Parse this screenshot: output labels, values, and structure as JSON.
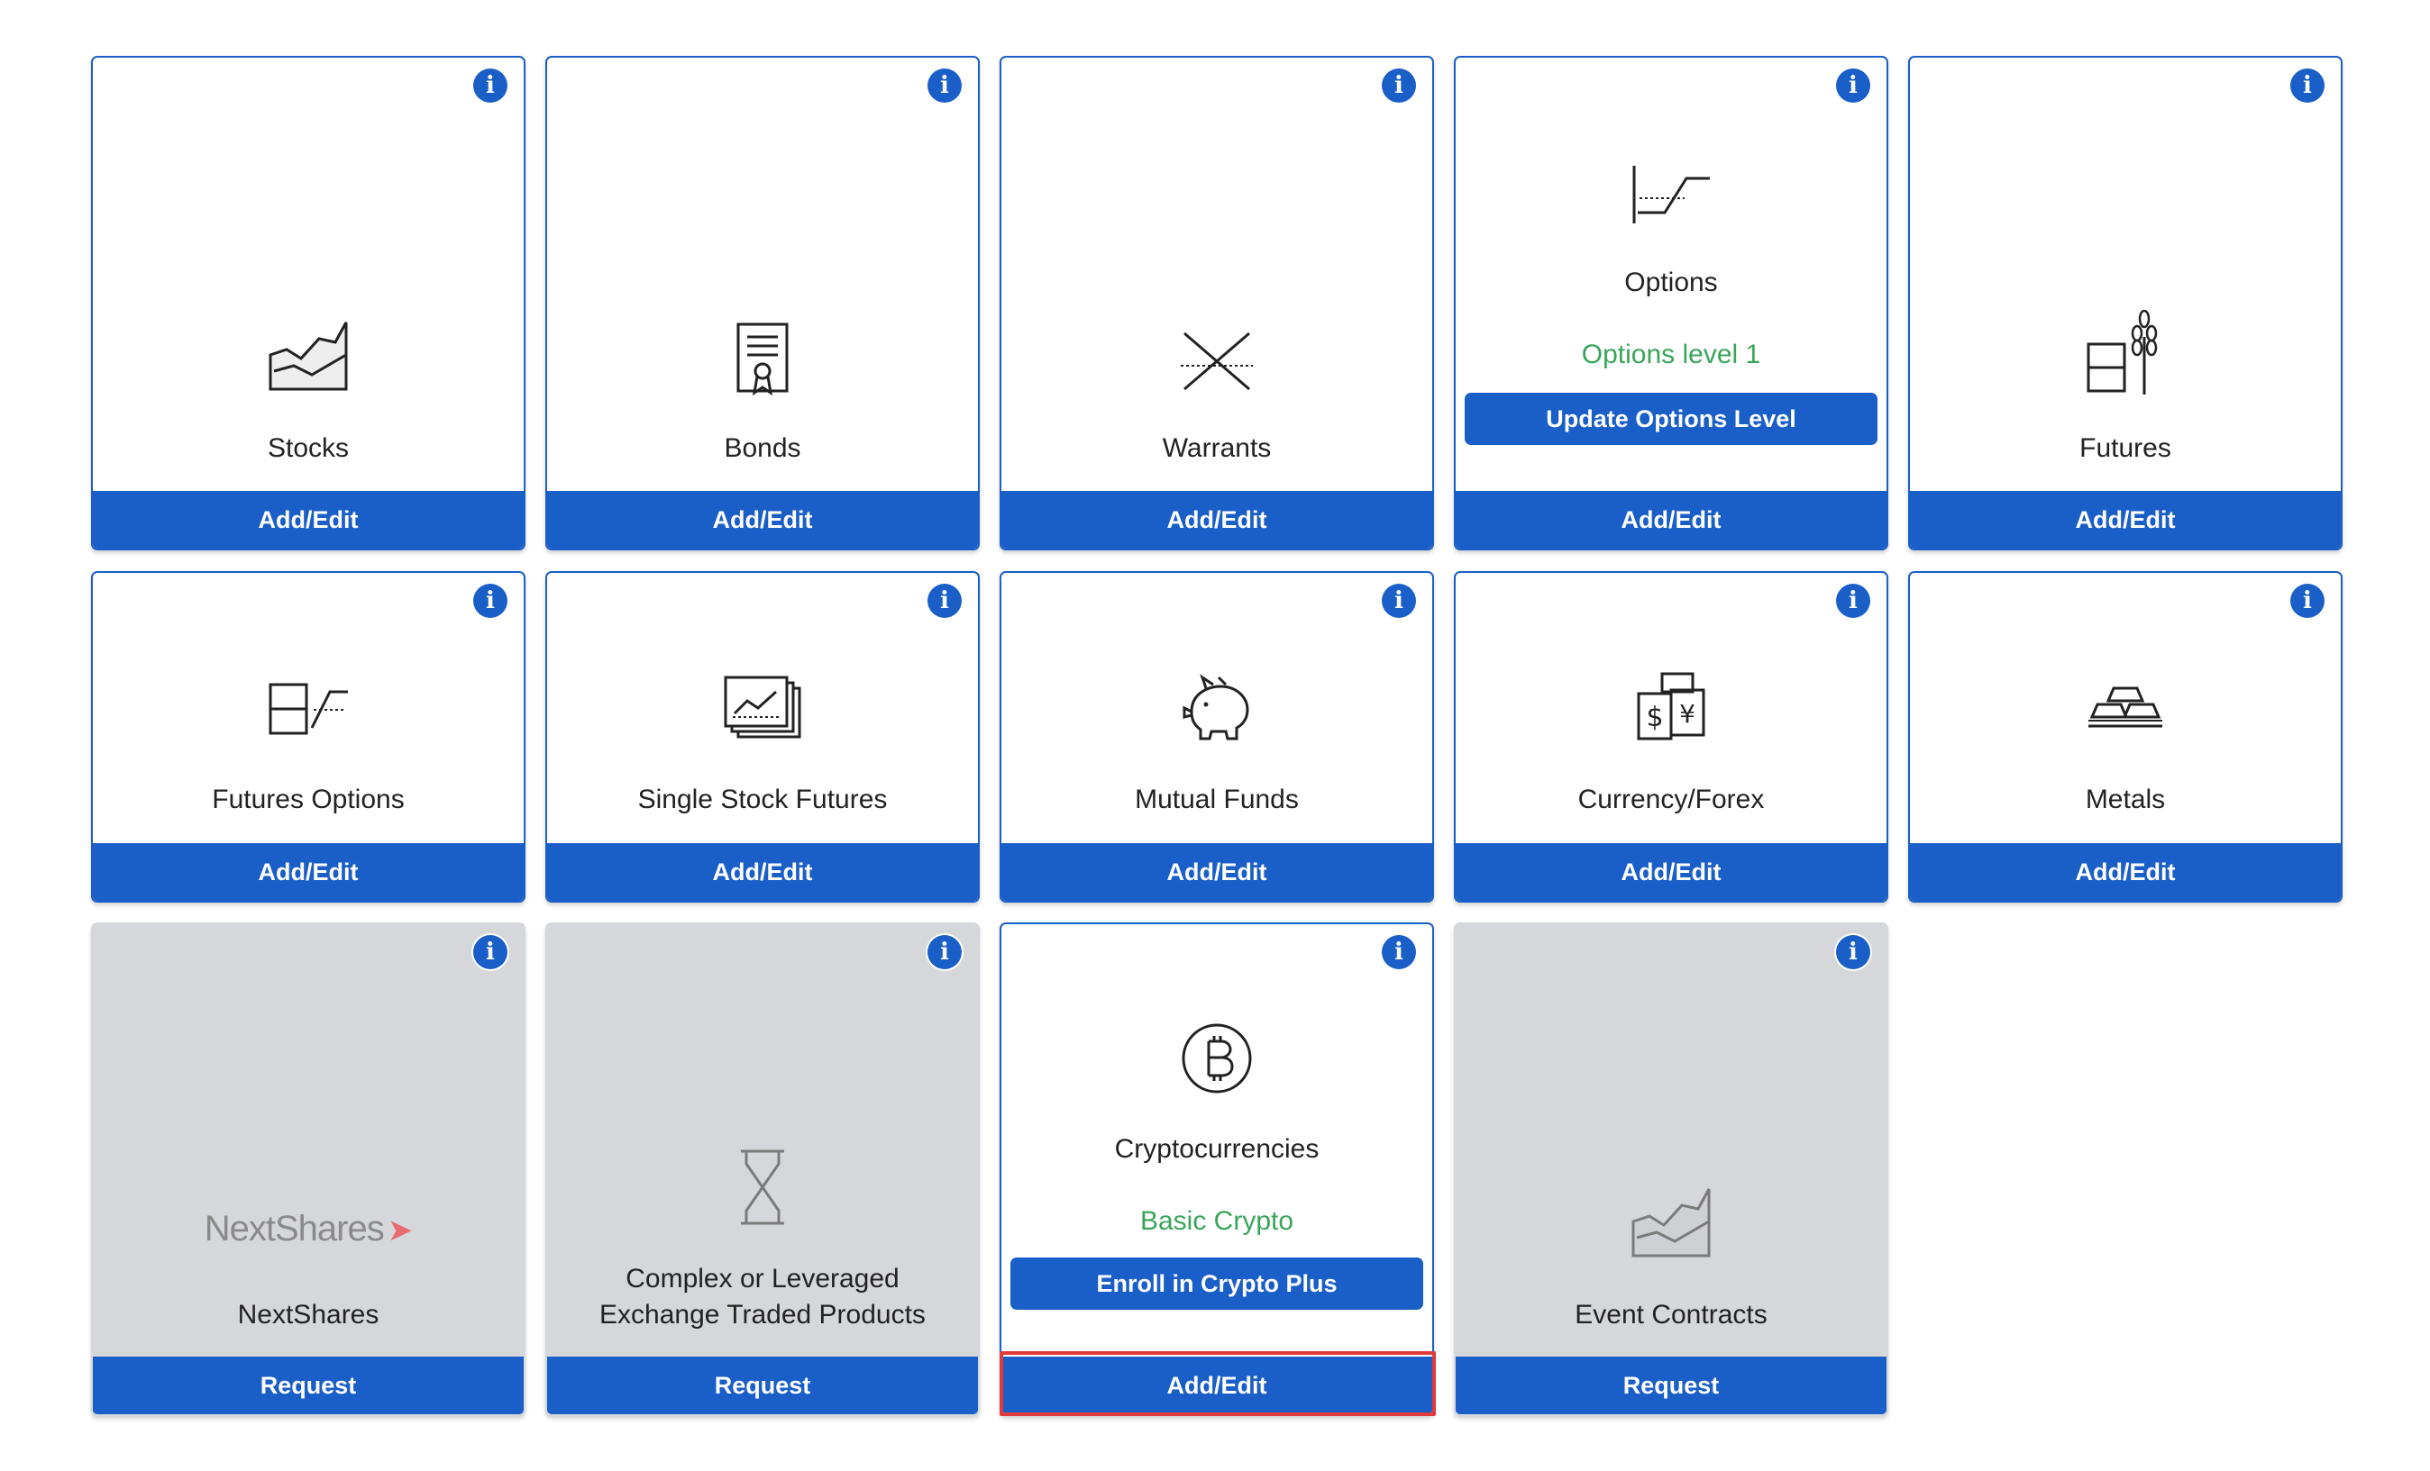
{
  "tiles": [
    {
      "name": "stocks",
      "label": "Stocks",
      "button": "Add/Edit",
      "icon": "stocks-chart-icon"
    },
    {
      "name": "bonds",
      "label": "Bonds",
      "button": "Add/Edit",
      "icon": "bond-certificate-icon"
    },
    {
      "name": "warrants",
      "label": "Warrants",
      "button": "Add/Edit",
      "icon": "warrants-cross-icon"
    },
    {
      "name": "options",
      "label": "Options",
      "level": "Options level 1",
      "action": "Update Options Level",
      "button": "Add/Edit",
      "icon": "options-payoff-icon"
    },
    {
      "name": "futures",
      "label": "Futures",
      "button": "Add/Edit",
      "icon": "futures-barrel-wheat-icon"
    },
    {
      "name": "futures-options",
      "label": "Futures Options",
      "button": "Add/Edit",
      "icon": "futures-options-icon"
    },
    {
      "name": "single-stock-futures",
      "label": "Single Stock Futures",
      "button": "Add/Edit",
      "icon": "single-stock-futures-icon"
    },
    {
      "name": "mutual-funds",
      "label": "Mutual Funds",
      "button": "Add/Edit",
      "icon": "piggy-bank-icon"
    },
    {
      "name": "currency-forex",
      "label": "Currency/Forex",
      "button": "Add/Edit",
      "icon": "currency-notes-icon"
    },
    {
      "name": "metals",
      "label": "Metals",
      "button": "Add/Edit",
      "icon": "gold-bars-icon"
    },
    {
      "name": "nextshares",
      "label": "NextShares",
      "logo": "NextShares",
      "button": "Request",
      "icon": "nextshares-logo-icon"
    },
    {
      "name": "complex-etp",
      "label_line1": "Complex or Leveraged",
      "label_line2": "Exchange Traded Products",
      "button": "Request",
      "icon": "hourglass-icon"
    },
    {
      "name": "cryptocurrencies",
      "label": "Cryptocurrencies",
      "level": "Basic Crypto",
      "action": "Enroll in Crypto Plus",
      "button": "Add/Edit",
      "icon": "bitcoin-icon"
    },
    {
      "name": "event-contracts",
      "label": "Event Contracts",
      "button": "Request",
      "icon": "event-contracts-chart-icon"
    }
  ],
  "info_glyph": "i",
  "colors": {
    "primary": "#1a5fc7",
    "level_text": "#3aa55a",
    "disabled_bg": "#d6d7db",
    "highlight": "#e03a3a"
  }
}
